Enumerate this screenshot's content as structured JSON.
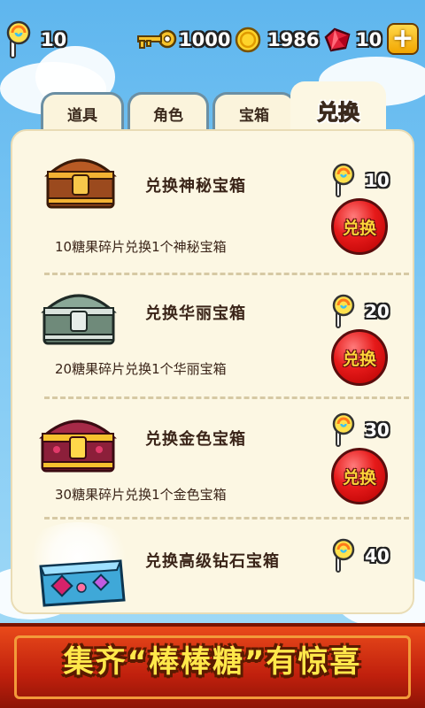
{
  "hud": {
    "lollipop_count": "10",
    "key_count": "1000",
    "gold_count": "1986",
    "gem_count": "10",
    "plus_label": "+"
  },
  "tabs": [
    {
      "label": "道具",
      "active": false
    },
    {
      "label": "角色",
      "active": false
    },
    {
      "label": "宝箱",
      "active": false
    },
    {
      "label": "兑换",
      "active": true
    }
  ],
  "items": [
    {
      "title": "兑换神秘宝箱",
      "desc": "10糖果碎片兑换1个神秘宝箱",
      "cost": "10",
      "button": "兑换",
      "icon": "wooden-chest-icon"
    },
    {
      "title": "兑换华丽宝箱",
      "desc": "20糖果碎片兑换1个华丽宝箱",
      "cost": "20",
      "button": "兑换",
      "icon": "silver-chest-icon"
    },
    {
      "title": "兑换金色宝箱",
      "desc": "30糖果碎片兑换1个金色宝箱",
      "cost": "30",
      "button": "兑换",
      "icon": "gold-chest-icon"
    },
    {
      "title": "兑换高级钻石宝箱",
      "desc": "",
      "cost": "40",
      "button": "",
      "icon": "diamond-chest-icon"
    }
  ],
  "banner": {
    "text": "集齐“棒棒糖”有惊喜"
  },
  "colors": {
    "accent_red": "#e61a1a",
    "panel_bg": "#fcf7e3",
    "gold": "#ffd53a"
  }
}
